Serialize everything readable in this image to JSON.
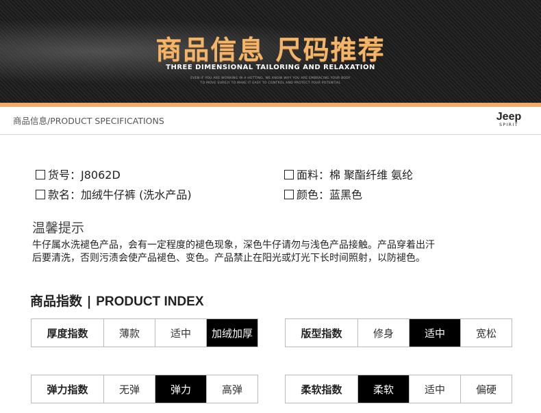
{
  "banner": {
    "title": "商品信息 尺码推荐",
    "subtitle": "THREE DIMENSIONAL TAILORING AND RELAXATION",
    "small_line1": "EVEN IF YOU ARE WORKING IN A HOTTING, WE KNOW WHY YOU ARE EMBRACING YOUR BODY",
    "small_line2": "TO MOVE SURELY TO MAKE IT EASY TO CONTROL AND PROTECT YOUR POTENTIAL"
  },
  "spec_header": {
    "title": "商品信息/PRODUCT SPECIFICATIONS",
    "logo_main": "Jeep",
    "logo_sub": "SPIRIT"
  },
  "specs": {
    "item_no": "货号：J8062D",
    "style": "款名：加绒牛仔裤 (洗水产品)",
    "fabric": "面料：棉 聚酯纤维 氨纶",
    "color": "颜色：蓝黑色"
  },
  "tips": {
    "title": "温馨提示",
    "line1": "牛仔属水洗褪色产品，会有一定程度的褪色现象，深色牛仔请勿与浅色产品接触。产品穿着出汗",
    "line2": "后要清洗，否则污渍会使产品褪色、变色。产品禁止在阳光或灯光下长时间照射，以防褪色。"
  },
  "product_index": {
    "title_cn": "商品指数",
    "separator": "|",
    "title_en": "PRODUCT INDEX",
    "thickness": {
      "label": "厚度指数",
      "options": [
        "薄款",
        "适中",
        "加绒加厚"
      ],
      "selected": 2
    },
    "fit": {
      "label": "版型指数",
      "options": [
        "修身",
        "适中",
        "宽松"
      ],
      "selected": 1
    },
    "elasticity": {
      "label": "弹力指数",
      "options": [
        "无弹",
        "弹力",
        "高弹"
      ],
      "selected": 1
    },
    "softness": {
      "label": "柔软指数",
      "options": [
        "柔软",
        "适中",
        "偏硬"
      ],
      "selected": 0
    }
  },
  "colors": {
    "accent_orange": "#f3a968",
    "title_gold": "#f2b56a",
    "selected_bg": "#000000"
  }
}
